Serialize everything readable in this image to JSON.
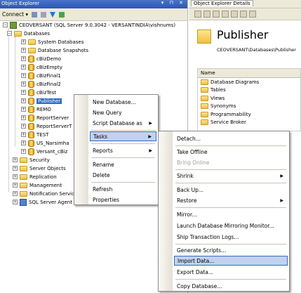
{
  "object_explorer": {
    "title": "Object Explorer",
    "title_buttons": "▾ ⊓ ✕",
    "connect_label": "Connect ▾",
    "server_node": "CEOVERSANT (SQL Server 9.0.3042 - VERSANTINDIA\\vishnums)",
    "databases_label": "Databases",
    "database_items": [
      "System Databases",
      "Database Snapshots",
      "cBizDemo",
      "cBizEmpty",
      "cBizFinal1",
      "cBizFinal2",
      "cBizTest",
      "Publisher",
      "REMO",
      "ReportServer",
      "ReportServerT",
      "TEST",
      "US_Narsimha",
      "Versant_cBiz"
    ],
    "selected_database": "Publisher",
    "server_items": [
      "Security",
      "Server Objects",
      "Replication",
      "Management",
      "Notification Services",
      "SQL Server Agent"
    ]
  },
  "details": {
    "tab_label": "Object Explorer Details",
    "title": "Publisher",
    "path": "CEOVERSANT\\Databases\\Publisher",
    "column_header": "Name",
    "items": [
      "Database Diagrams",
      "Tables",
      "Views",
      "Synonyms",
      "Programmability",
      "Service Broker"
    ]
  },
  "context_menu": {
    "items": [
      "New Database...",
      "New Query",
      "Script Database as",
      "Tasks",
      "Reports",
      "Rename",
      "Delete",
      "Refresh",
      "Properties"
    ],
    "highlighted": "Tasks"
  },
  "tasks_menu": {
    "items": [
      "Detach...",
      "Take Offline",
      "Bring Online",
      "Shrink",
      "Back Up...",
      "Restore",
      "Mirror...",
      "Launch Database Mirroring Monitor...",
      "Ship Transaction Logs...",
      "Generate Scripts...",
      "Import Data...",
      "Export Data...",
      "Copy Database..."
    ],
    "disabled": "Bring Online",
    "highlighted": "Import Data..."
  },
  "colors": {
    "title_bar": "#2a56b5",
    "selection": "#316ac5",
    "menu_highlight": "#c1d2ee"
  }
}
